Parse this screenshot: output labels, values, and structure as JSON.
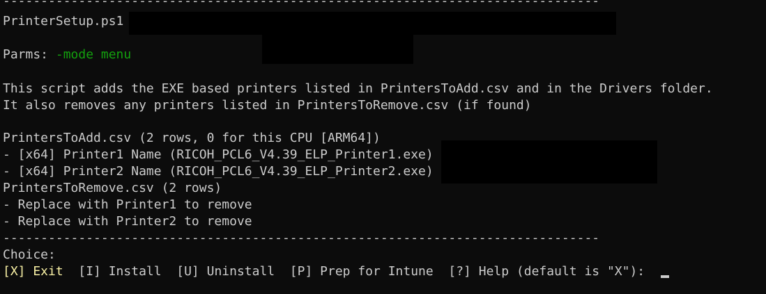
{
  "colors": {
    "background": "#0c0c0c",
    "text": "#cccccc",
    "param_value": "#13a10e",
    "selected_option": "#f9f1a5"
  },
  "terminal": {
    "separator": "-------------------------------------------------------------------------------",
    "script_name": "PrinterSetup.ps1",
    "parms_label": "Parms: ",
    "parms_value": "-mode menu",
    "description_lines": [
      "This script adds the EXE based printers listed in PrintersToAdd.csv and in the Drivers folder.",
      "It also removes any printers listed in PrintersToRemove.csv (if found)"
    ],
    "add_header": "PrintersToAdd.csv (2 rows, 0 for this CPU [ARM64])",
    "add_items": [
      "- [x64] Printer1 Name (RICOH_PCL6_V4.39_ELP_Printer1.exe)",
      "- [x64] Printer2 Name (RICOH_PCL6_V4.39_ELP_Printer2.exe)"
    ],
    "remove_header": "PrintersToRemove.csv (2 rows)",
    "remove_items": [
      "- Replace with Printer1 to remove",
      "- Replace with Printer2 to remove"
    ],
    "choice_label": "Choice:",
    "menu": {
      "default_option": "[X] Exit",
      "rest": "  [I] Install  [U] Uninstall  [P] Prep for Intune  [?] Help (default is \"X\"): "
    }
  }
}
